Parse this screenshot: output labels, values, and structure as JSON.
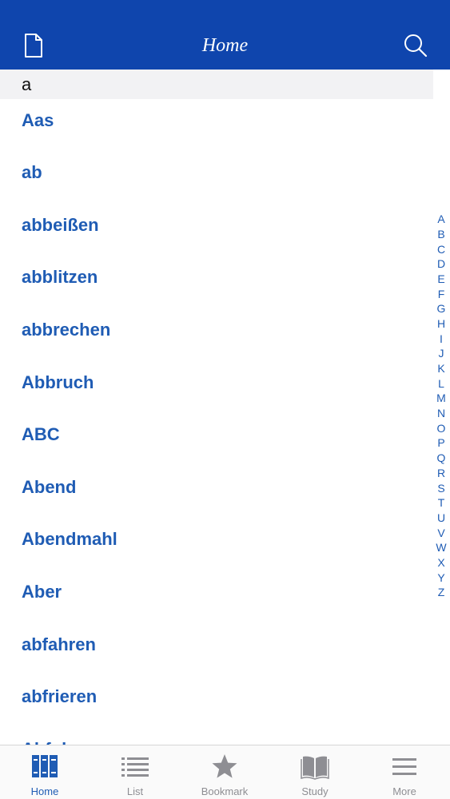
{
  "header": {
    "title": "Home",
    "left_icon": "document-icon",
    "right_icon": "search-icon"
  },
  "section": {
    "letter": "a"
  },
  "words": [
    "Aas",
    "ab",
    "abbeißen",
    "abblitzen",
    "abbrechen",
    "Abbruch",
    "ABC",
    "Abend",
    "Abendmahl",
    "Aber",
    "abfahren",
    "abfrieren",
    "Abfuhr"
  ],
  "alphabet": [
    "A",
    "B",
    "C",
    "D",
    "E",
    "F",
    "G",
    "H",
    "I",
    "J",
    "K",
    "L",
    "M",
    "N",
    "O",
    "P",
    "Q",
    "R",
    "S",
    "T",
    "U",
    "V",
    "W",
    "X",
    "Y",
    "Z"
  ],
  "tabs": [
    {
      "label": "Home",
      "icon": "books-icon",
      "active": true
    },
    {
      "label": "List",
      "icon": "list-icon",
      "active": false
    },
    {
      "label": "Bookmark",
      "icon": "star-icon",
      "active": false
    },
    {
      "label": "Study",
      "icon": "open-book-icon",
      "active": false
    },
    {
      "label": "More",
      "icon": "menu-icon",
      "active": false
    }
  ],
  "colors": {
    "header_bg": "#0f45ad",
    "accent": "#1f5cb4",
    "inactive_tab": "#8e8e93",
    "section_bg": "#f2f2f4"
  }
}
